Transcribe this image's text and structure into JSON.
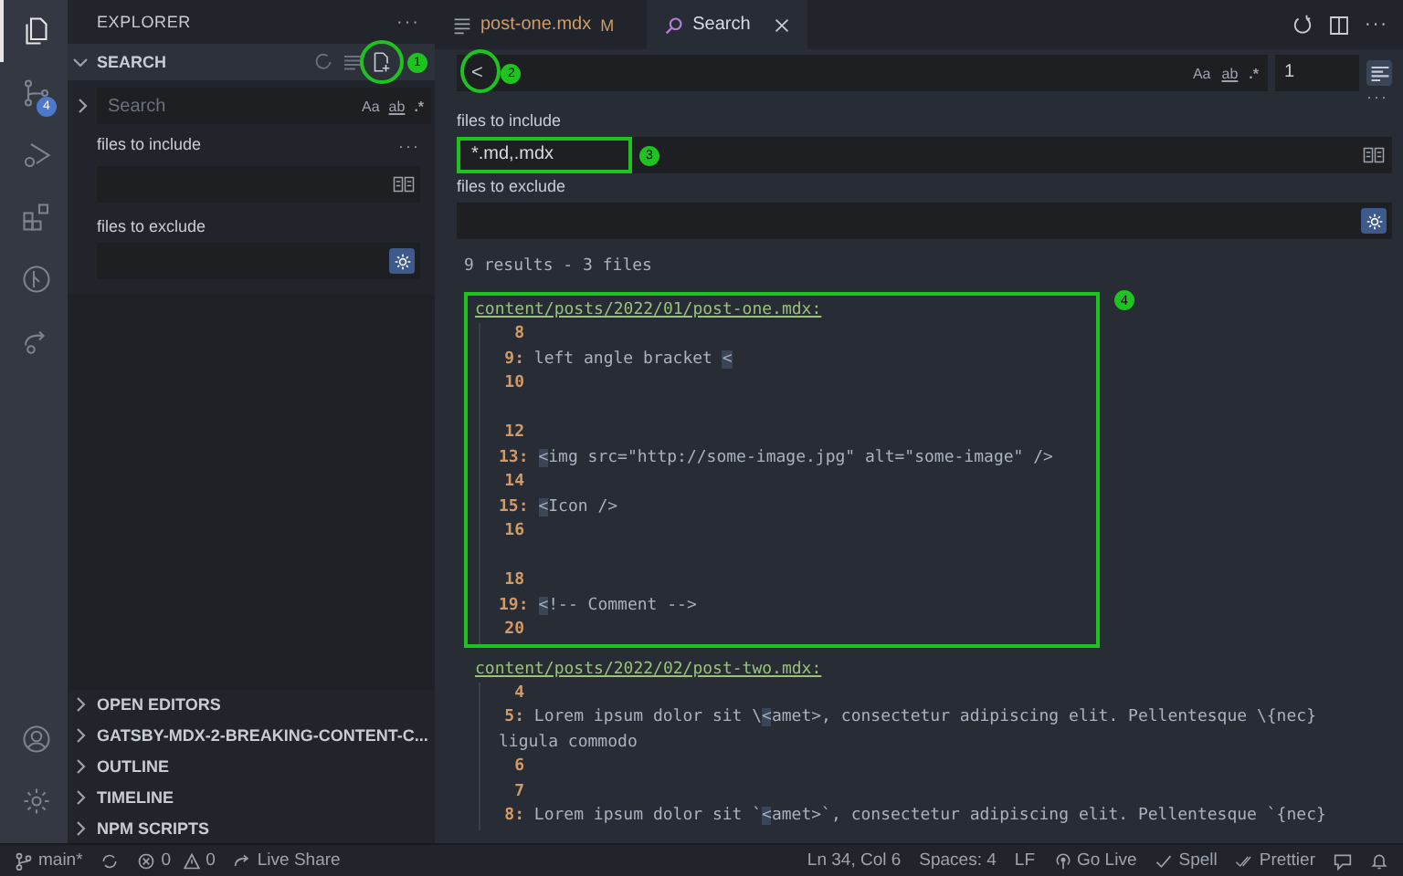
{
  "activity_bar": {
    "items": [
      {
        "selected": true
      },
      {
        "selected": false,
        "badge": "4"
      },
      {
        "selected": false
      },
      {
        "selected": false
      },
      {
        "selected": false
      },
      {
        "selected": false
      }
    ]
  },
  "sidebar": {
    "title": "EXPLORER",
    "more": "···",
    "search": {
      "title": "SEARCH",
      "expanded": true,
      "new_file_annotation": "1",
      "placeholder": "Search",
      "toggles": [
        "Aa",
        "ab",
        ".*"
      ],
      "more": "···",
      "include_label": "files to include",
      "exclude_label": "files to exclude",
      "exclude_settings_on": true
    },
    "sections": [
      {
        "title": "OPEN EDITORS",
        "expanded": false
      },
      {
        "title": "GATSBY-MDX-2-BREAKING-CONTENT-C...",
        "expanded": false
      },
      {
        "title": "OUTLINE",
        "expanded": false
      },
      {
        "title": "TIMELINE",
        "expanded": false
      },
      {
        "title": "NPM SCRIPTS",
        "expanded": false
      }
    ]
  },
  "tabs": [
    {
      "label": "post-one.mdx",
      "badge": "M",
      "kind": "file",
      "selected": false
    },
    {
      "label": "Search",
      "kind": "search",
      "selected": true
    }
  ],
  "tab_actions_more": "···",
  "search_editor": {
    "query": "<",
    "query_annotation": "2",
    "toggles": [
      "Aa",
      "ab",
      ".*"
    ],
    "context_lines": "1",
    "context_on": true,
    "more": "···",
    "include_label": "files to include",
    "include_value": "*.md,.mdx",
    "include_annotation": "3",
    "exclude_label": "files to exclude",
    "exclude_settings_on": true,
    "summary": "9 results - 3 files",
    "groups": [
      {
        "path": "content/posts/2022/01/post-one.mdx:",
        "annotation": "4",
        "lines": [
          {
            "kind": "context",
            "num": "8"
          },
          {
            "kind": "match",
            "num": "9:",
            "before": "left angle bracket ",
            "match": "<"
          },
          {
            "kind": "context",
            "num": "10"
          },
          {
            "kind": "gap"
          },
          {
            "kind": "context",
            "num": "12"
          },
          {
            "kind": "match",
            "num": "13:",
            "match": "<",
            "after": "img src=\"http://some-image.jpg\" alt=\"some-image\" />"
          },
          {
            "kind": "context",
            "num": "14"
          },
          {
            "kind": "match",
            "num": "15:",
            "match": "<",
            "after": "Icon />"
          },
          {
            "kind": "context",
            "num": "16"
          },
          {
            "kind": "gap"
          },
          {
            "kind": "context",
            "num": "18"
          },
          {
            "kind": "match",
            "num": "19:",
            "match": "<",
            "after": "!-- Comment -->"
          },
          {
            "kind": "context",
            "num": "20"
          }
        ]
      },
      {
        "path": "content/posts/2022/02/post-two.mdx:",
        "lines": [
          {
            "kind": "context",
            "num": "4"
          },
          {
            "kind": "match",
            "num": "5:",
            "before": "Lorem ipsum dolor sit \\",
            "match": "<",
            "after": "amet>, consectetur adipiscing elit. Pellentesque \\{nec} ligula commodo"
          },
          {
            "kind": "context",
            "num": "6"
          },
          {
            "kind": "context",
            "num": "7"
          },
          {
            "kind": "match",
            "num": "8:",
            "before": "Lorem ipsum dolor sit `",
            "match": "<",
            "after": "amet>`, consectetur adipiscing elit. Pellentesque `{nec}"
          }
        ]
      }
    ]
  },
  "status_bar": {
    "branch": "main*",
    "errors": "0",
    "warnings": "0",
    "live_share": "Live Share",
    "position": "Ln 34, Col 6",
    "spaces": "Spaces: 4",
    "eol": "LF",
    "go_live": "Go Live",
    "spell": "Spell",
    "prettier": "Prettier"
  }
}
